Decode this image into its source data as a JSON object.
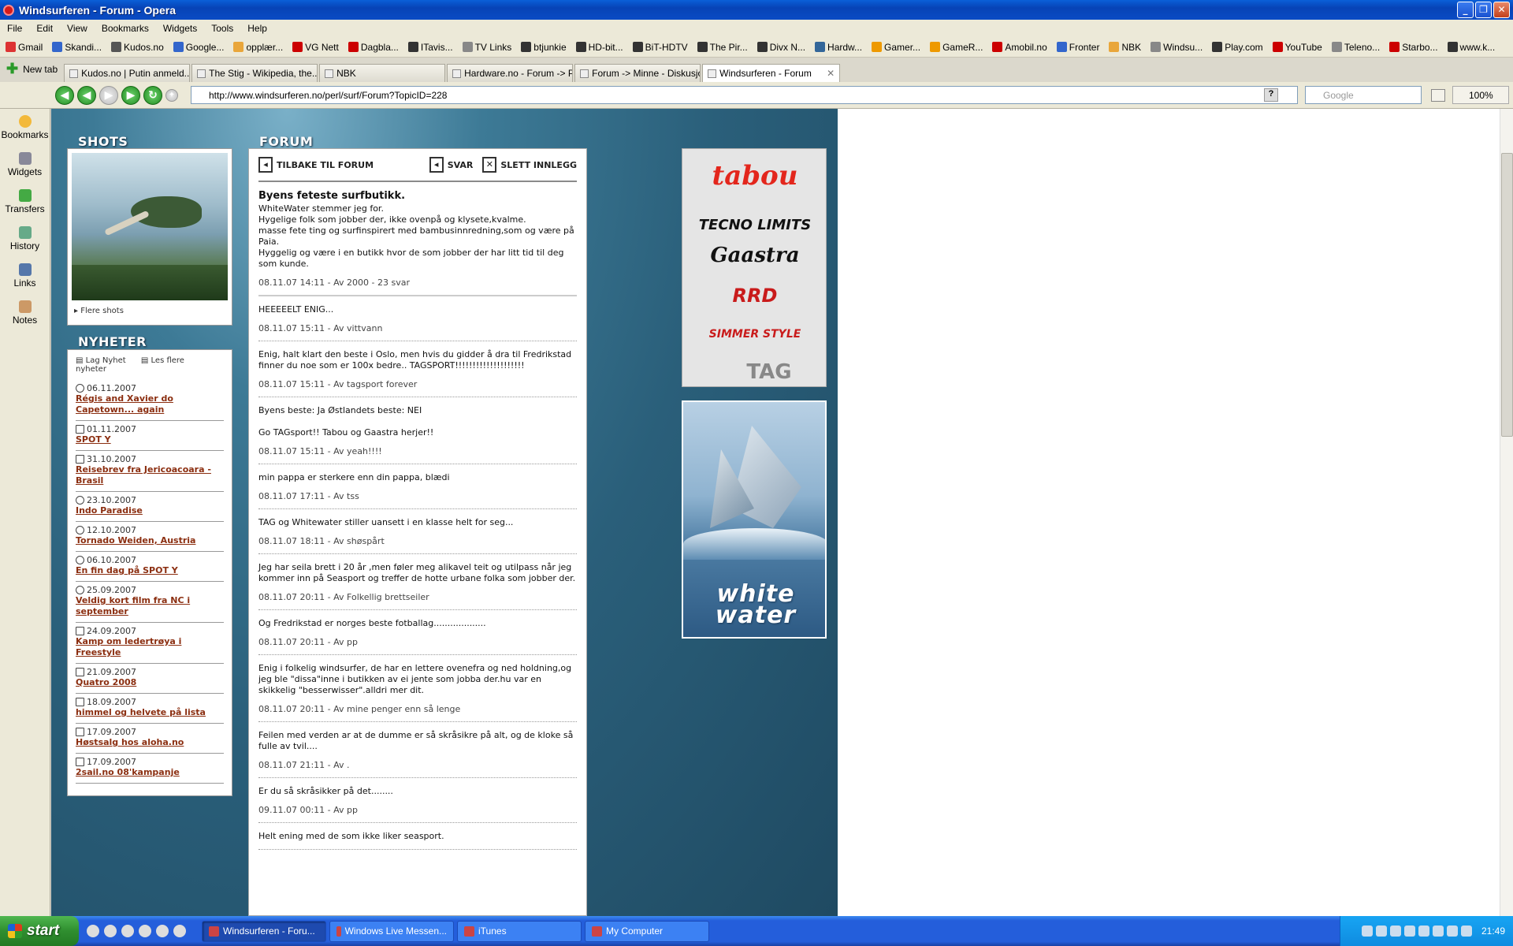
{
  "window": {
    "title": "Windsurferen - Forum - Opera"
  },
  "menu": [
    "File",
    "Edit",
    "View",
    "Bookmarks",
    "Widgets",
    "Tools",
    "Help"
  ],
  "bookmarks": [
    {
      "label": "Gmail",
      "color": "#d33"
    },
    {
      "label": "Skandi...",
      "color": "#36c"
    },
    {
      "label": "Kudos.no",
      "color": "#555"
    },
    {
      "label": "Google...",
      "color": "#36c"
    },
    {
      "label": "opplær...",
      "color": "#e9a63a"
    },
    {
      "label": "VG Nett",
      "color": "#c00"
    },
    {
      "label": "Dagbla...",
      "color": "#c00"
    },
    {
      "label": "ITavis...",
      "color": "#333"
    },
    {
      "label": "TV Links",
      "color": "#888"
    },
    {
      "label": "btjunkie",
      "color": "#333"
    },
    {
      "label": "HD-bit...",
      "color": "#333"
    },
    {
      "label": "BiT-HDTV",
      "color": "#333"
    },
    {
      "label": "The Pir...",
      "color": "#333"
    },
    {
      "label": "Divx N...",
      "color": "#333"
    },
    {
      "label": "Hardw...",
      "color": "#369"
    },
    {
      "label": "Gamer...",
      "color": "#e90"
    },
    {
      "label": "GameR...",
      "color": "#e90"
    },
    {
      "label": "Amobil.no",
      "color": "#c00"
    },
    {
      "label": "Fronter",
      "color": "#36c"
    },
    {
      "label": "NBK",
      "color": "#e9a63a"
    },
    {
      "label": "Windsu...",
      "color": "#888"
    },
    {
      "label": "Play.com",
      "color": "#333"
    },
    {
      "label": "YouTube",
      "color": "#c00"
    },
    {
      "label": "Teleno...",
      "color": "#888"
    },
    {
      "label": "Starbo...",
      "color": "#c00"
    },
    {
      "label": "www.k...",
      "color": "#333"
    }
  ],
  "tabs": {
    "new_tab": "New tab",
    "items": [
      {
        "label": "Kudos.no | Putin anmeld...",
        "active": false
      },
      {
        "label": "The Stig - Wikipedia, the...",
        "active": false
      },
      {
        "label": "NBK",
        "active": false
      },
      {
        "label": "Hardware.no - Forum -> Po...",
        "active": false
      },
      {
        "label": "Forum -> Minne - Diskusjon.no",
        "active": false
      },
      {
        "label": "Windsurferen - Forum",
        "active": true
      }
    ]
  },
  "nav": {
    "url": "http://www.windsurferen.no/perl/surf/Forum?TopicID=228",
    "search_placeholder": "Google",
    "zoom": "100%"
  },
  "panel": [
    "Bookmarks",
    "Widgets",
    "Transfers",
    "History",
    "Links",
    "Notes"
  ],
  "page": {
    "shots_heading": "SHOTS",
    "shots_more": "Flere shots",
    "news_heading": "NYHETER",
    "news_actions": {
      "add": "Lag Nyhet",
      "read": "Les flere nyheter"
    },
    "news": [
      {
        "date": "06.11.2007",
        "title": "Régis and Xavier do Capetown... again",
        "icon": "play"
      },
      {
        "date": "01.11.2007",
        "title": "SPOT Y",
        "icon": "doc"
      },
      {
        "date": "31.10.2007",
        "title": "Reisebrev fra Jericoacoara - Brasil",
        "icon": "doc"
      },
      {
        "date": "23.10.2007",
        "title": "Indo Paradise",
        "icon": "play"
      },
      {
        "date": "12.10.2007",
        "title": "Tornado Weiden, Austria",
        "icon": "play"
      },
      {
        "date": "06.10.2007",
        "title": "En fin dag på SPOT Y",
        "icon": "play"
      },
      {
        "date": "25.09.2007",
        "title": "Veldig kort film fra NC i september",
        "icon": "play"
      },
      {
        "date": "24.09.2007",
        "title": "Kamp om ledertrøya i Freestyle",
        "icon": "doc"
      },
      {
        "date": "21.09.2007",
        "title": "Quatro 2008",
        "icon": "doc"
      },
      {
        "date": "18.09.2007",
        "title": "himmel og helvete på lista",
        "icon": "doc"
      },
      {
        "date": "17.09.2007",
        "title": "Høstsalg hos aloha.no",
        "icon": "doc"
      },
      {
        "date": "17.09.2007",
        "title": "2sail.no 08'kampanje",
        "icon": "doc"
      }
    ],
    "forum_heading": "FORUM",
    "forum_actions": {
      "back": "TILBAKE TIL FORUM",
      "reply": "SVAR",
      "delete": "SLETT INNLEGG"
    },
    "topic": {
      "subject": "Byens feteste surfbutikk.",
      "body": "WhiteWater stemmer jeg for.\nHygelige folk som jobber der, ikke ovenpå og klysete,kvalme.\nmasse fete ting og surfinspirert med bambusinnredning,som og være på Paia.\nHyggelig og være i en butikk hvor de som jobber der har litt tid til deg som kunde.",
      "meta": "08.11.07 14:11 - Av 2000 - 23 svar"
    },
    "posts": [
      {
        "body": "HEEEEELT ENIG...",
        "meta": "08.11.07 15:11 - Av vittvann"
      },
      {
        "body": "Enig, halt klart den beste i Oslo, men hvis du gidder å dra til Fredrikstad finner du noe som er 100x bedre.. TAGSPORT!!!!!!!!!!!!!!!!!!!!",
        "meta": "08.11.07 15:11 - Av tagsport forever"
      },
      {
        "body": "Byens beste: Ja Østlandets beste: NEI\n\nGo TAGsport!! Tabou og Gaastra herjer!!",
        "meta": "08.11.07 15:11 - Av yeah!!!!"
      },
      {
        "body": "min pappa er sterkere enn din pappa, blædi",
        "meta": "08.11.07 17:11 - Av tss"
      },
      {
        "body": "TAG og Whitewater stiller uansett i en klasse helt for seg...",
        "meta": "08.11.07 18:11 - Av shøspårt"
      },
      {
        "body": "Jeg har seila brett i 20 år ,men føler meg alikavel teit og utilpass når jeg kommer inn på Seasport og treffer de hotte urbane folka som jobber der.",
        "meta": "08.11.07 20:11 - Av Folkellig brettseiler"
      },
      {
        "body": "Og Fredrikstad er norges beste fotballag...................",
        "meta": "08.11.07 20:11 - Av pp"
      },
      {
        "body": "Enig i folkelig windsurfer, de har en lettere ovenefra og ned holdning,og jeg ble \"dissa\"inne i butikken av ei jente som jobba der.hu var en skikkelig \"besserwisser\".alldri mer dit.",
        "meta": "08.11.07 20:11 - Av mine penger enn så lenge"
      },
      {
        "body": "Feilen med verden ar at de dumme er så skråsikre på alt, og de kloke så fulle av tvil....",
        "meta": "08.11.07 21:11 - Av ."
      },
      {
        "body": "Er du så skråsikker på det........",
        "meta": "09.11.07 00:11 - Av pp"
      },
      {
        "body": "Helt ening med de som ikke liker seasport.",
        "meta": ""
      }
    ],
    "sponsors": [
      "tabou",
      "TECNO LIMITS",
      "Gaastra",
      "RRD",
      "SIMMER STYLE",
      "TAG"
    ],
    "ad_brand": "white water"
  },
  "taskbar": {
    "start": "start",
    "items": [
      {
        "label": "Windsurferen - Foru...",
        "active": true
      },
      {
        "label": "Windows Live Messen...",
        "active": false
      },
      {
        "label": "iTunes",
        "active": false
      },
      {
        "label": "My Computer",
        "active": false
      }
    ],
    "clock": "21:49"
  }
}
